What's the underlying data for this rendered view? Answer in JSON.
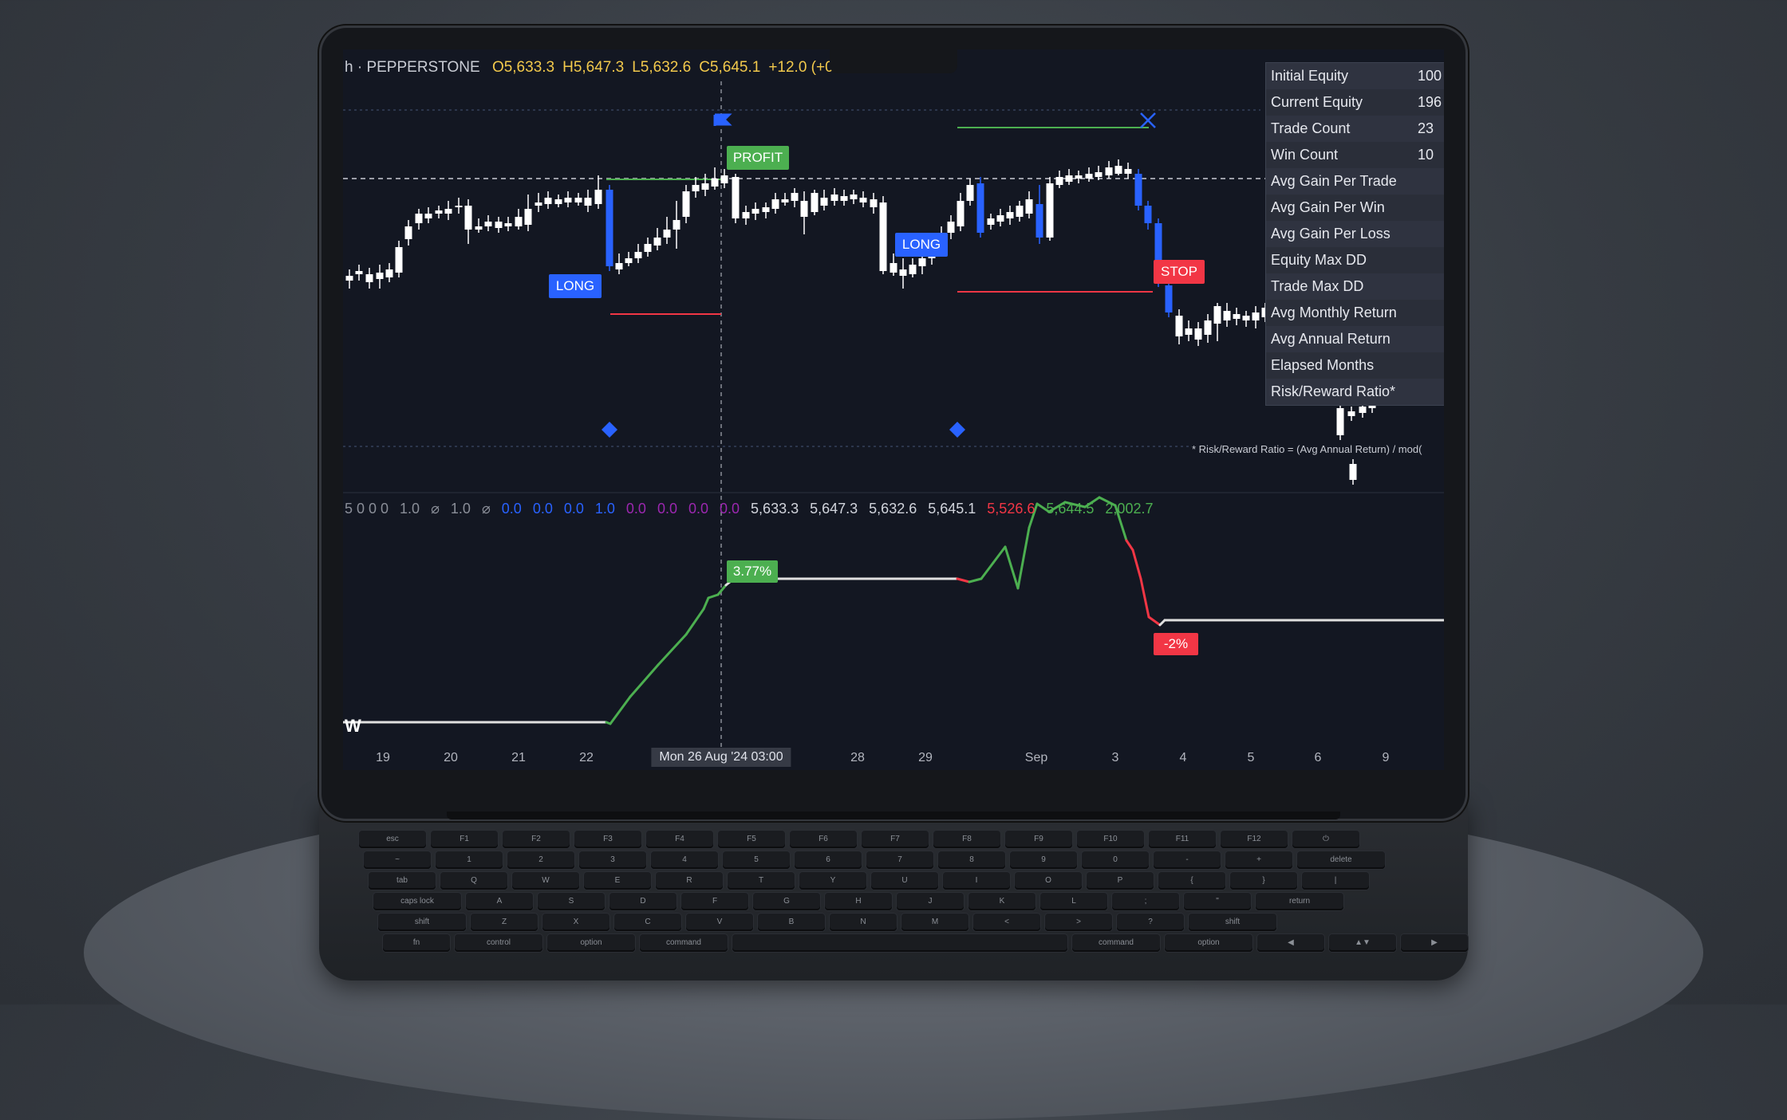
{
  "header": {
    "symbol": "h · PEPPERSTONE",
    "o": "O5,633.3",
    "h": "H5,647.3",
    "l": "L5,632.6",
    "c": "C5,645.1",
    "chg": "+12.0 (+0"
  },
  "tags": {
    "long1": "LONG",
    "long2": "LONG",
    "profit": "PROFIT",
    "stop": "STOP",
    "gain": "3.77%",
    "loss": "-2%",
    "w": "W"
  },
  "stats": [
    {
      "label": "Initial Equity",
      "value": "100"
    },
    {
      "label": "Current Equity",
      "value": "196"
    },
    {
      "label": "Trade Count",
      "value": "23"
    },
    {
      "label": "Win Count",
      "value": "10"
    },
    {
      "label": "Avg Gain Per Trade",
      "value": ""
    },
    {
      "label": "Avg Gain Per Win",
      "value": ""
    },
    {
      "label": "Avg Gain Per Loss",
      "value": ""
    },
    {
      "label": "Equity Max DD",
      "value": ""
    },
    {
      "label": "Trade Max DD",
      "value": ""
    },
    {
      "label": "Avg Monthly Return",
      "value": ""
    },
    {
      "label": "Avg Annual Return",
      "value": ""
    },
    {
      "label": "Elapsed Months",
      "value": ""
    },
    {
      "label": "Risk/Reward Ratio*",
      "value": ""
    }
  ],
  "footnote": "* Risk/Reward Ratio = (Avg Annual Return) / mod(",
  "indicator_values": [
    {
      "text": "5 0 0 0",
      "color": "#8a8e98"
    },
    {
      "text": "1.0",
      "color": "#8a8e98"
    },
    {
      "text": "⌀",
      "color": "#8a8e98"
    },
    {
      "text": "1.0",
      "color": "#8a8e98"
    },
    {
      "text": "⌀",
      "color": "#8a8e98"
    },
    {
      "text": "0.0",
      "color": "#2962ff"
    },
    {
      "text": "0.0",
      "color": "#2962ff"
    },
    {
      "text": "0.0",
      "color": "#2962ff"
    },
    {
      "text": "1.0",
      "color": "#2962ff"
    },
    {
      "text": "0.0",
      "color": "#9c27b0"
    },
    {
      "text": "0.0",
      "color": "#9c27b0"
    },
    {
      "text": "0.0",
      "color": "#9c27b0"
    },
    {
      "text": "0.0",
      "color": "#9c27b0"
    },
    {
      "text": "5,633.3",
      "color": "#d1d4dc"
    },
    {
      "text": "5,647.3",
      "color": "#d1d4dc"
    },
    {
      "text": "5,632.6",
      "color": "#d1d4dc"
    },
    {
      "text": "5,645.1",
      "color": "#d1d4dc"
    },
    {
      "text": "5,526.6",
      "color": "#f23645"
    },
    {
      "text": "5,644.5",
      "color": "#4caf50"
    },
    {
      "text": "2,002.7",
      "color": "#4caf50"
    }
  ],
  "date_axis": {
    "labels": [
      "19",
      "20",
      "21",
      "22",
      "28",
      "29",
      "Sep",
      "3",
      "4",
      "5",
      "6",
      "9"
    ],
    "crosshair_label": "Mon 26 Aug '24   03:00"
  },
  "colors": {
    "bull": "#ffffff",
    "bear": "#2962ff",
    "profit": "#4caf50",
    "stop": "#f23645",
    "equity_flat": "#e0e0e0"
  },
  "keyboard": {
    "rows": [
      [
        "esc",
        "F1",
        "F2",
        "F3",
        "F4",
        "F5",
        "F6",
        "F7",
        "F8",
        "F9",
        "F10",
        "F11",
        "F12",
        "⏻"
      ],
      [
        "~",
        "1",
        "2",
        "3",
        "4",
        "5",
        "6",
        "7",
        "8",
        "9",
        "0",
        "-",
        "+",
        "delete"
      ],
      [
        "tab",
        "Q",
        "W",
        "E",
        "R",
        "T",
        "Y",
        "U",
        "I",
        "O",
        "P",
        "{",
        "}",
        "|"
      ],
      [
        "caps lock",
        "A",
        "S",
        "D",
        "F",
        "G",
        "H",
        "J",
        "K",
        "L",
        ";",
        "\"",
        "return"
      ],
      [
        "shift",
        "Z",
        "X",
        "C",
        "V",
        "B",
        "N",
        "M",
        "<",
        ">",
        "?",
        "shift"
      ],
      [
        "fn",
        "control",
        "option",
        "command",
        "",
        "command",
        "option",
        "◀",
        "▲▼",
        "▶"
      ]
    ]
  }
}
